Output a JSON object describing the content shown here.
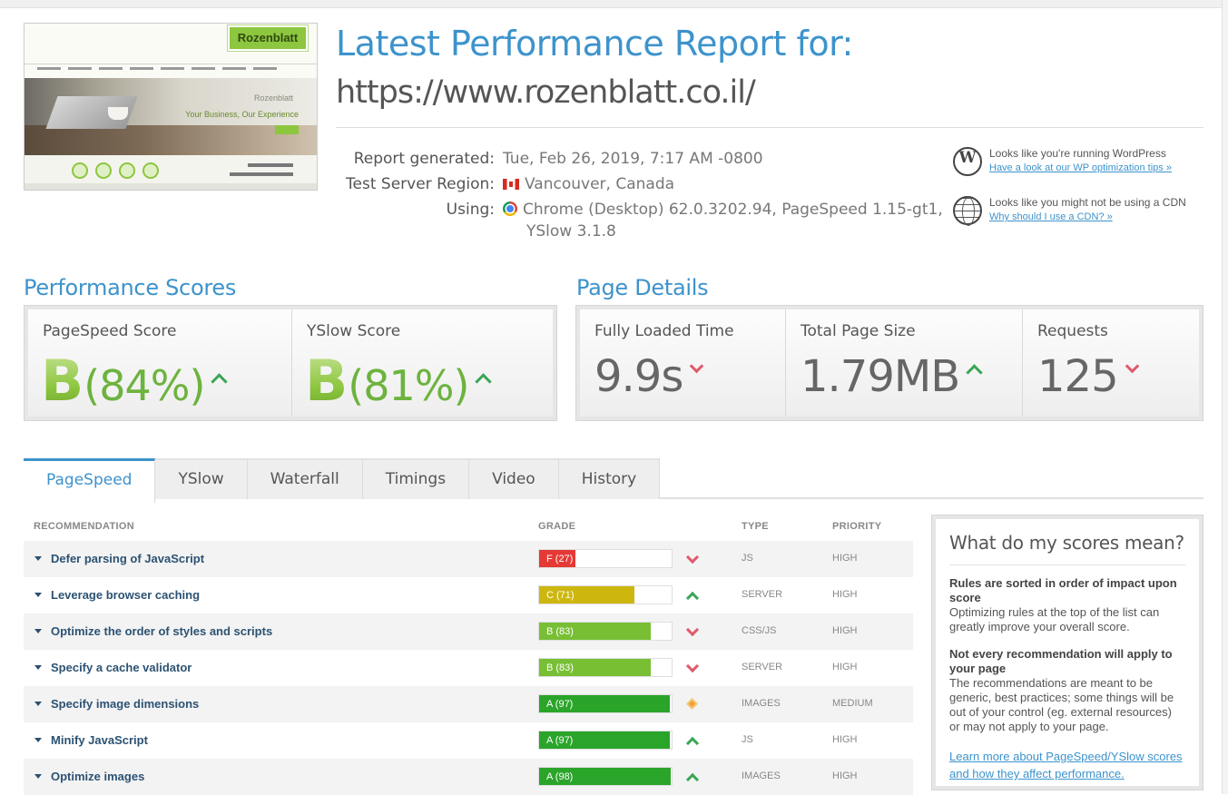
{
  "report": {
    "title": "Latest Performance Report for:",
    "url": "https://www.rozenblatt.co.il/",
    "thumbnail": {
      "logo_text": "Rozenblatt",
      "brand_text": "Rozenblatt",
      "tagline": "Your Business, Our Experience"
    },
    "generated_label": "Report generated:",
    "generated_value": "Tue, Feb 26, 2019, 7:17 AM -0800",
    "region_label": "Test Server Region:",
    "region_value": "Vancouver, Canada",
    "using_label": "Using:",
    "using_value_line1": "Chrome (Desktop) 62.0.3202.94, PageSpeed 1.15-gt1,",
    "using_value_line2": "YSlow 3.1.8"
  },
  "tips": [
    {
      "icon": "wordpress-icon",
      "text": "Looks like you're running WordPress",
      "link": "Have a look at our WP optimization tips »"
    },
    {
      "icon": "globe-icon",
      "text": "Looks like you might not be using a CDN",
      "link": "Why should I use a CDN? »"
    }
  ],
  "performance": {
    "heading": "Performance Scores",
    "pagespeed_label": "PageSpeed Score",
    "pagespeed_grade": "B",
    "pagespeed_pct": "(84%)",
    "yslow_label": "YSlow Score",
    "yslow_grade": "B",
    "yslow_pct": "(81%)"
  },
  "details": {
    "heading": "Page Details",
    "loaded_label": "Fully Loaded Time",
    "loaded_value": "9.9s",
    "size_label": "Total Page Size",
    "size_value": "1.79MB",
    "requests_label": "Requests",
    "requests_value": "125"
  },
  "tabs": [
    "PageSpeed",
    "YSlow",
    "Waterfall",
    "Timings",
    "Video",
    "History"
  ],
  "table": {
    "headers": {
      "recommendation": "RECOMMENDATION",
      "grade": "GRADE",
      "type": "TYPE",
      "priority": "PRIORITY"
    },
    "rows": [
      {
        "name": "Defer parsing of JavaScript",
        "grade": "F (27)",
        "score": 27,
        "color": "#e53935",
        "trend": "down",
        "type": "JS",
        "priority": "HIGH"
      },
      {
        "name": "Leverage browser caching",
        "grade": "C (71)",
        "score": 71,
        "color": "#cdb70e",
        "trend": "up",
        "type": "SERVER",
        "priority": "HIGH"
      },
      {
        "name": "Optimize the order of styles and scripts",
        "grade": "B (83)",
        "score": 83,
        "color": "#78bf34",
        "trend": "down",
        "type": "CSS/JS",
        "priority": "HIGH"
      },
      {
        "name": "Specify a cache validator",
        "grade": "B (83)",
        "score": 83,
        "color": "#78bf34",
        "trend": "down",
        "type": "SERVER",
        "priority": "HIGH"
      },
      {
        "name": "Specify image dimensions",
        "grade": "A (97)",
        "score": 97,
        "color": "#2aa52a",
        "trend": "neutral",
        "type": "IMAGES",
        "priority": "MEDIUM"
      },
      {
        "name": "Minify JavaScript",
        "grade": "A (97)",
        "score": 97,
        "color": "#2aa52a",
        "trend": "up",
        "type": "JS",
        "priority": "HIGH"
      },
      {
        "name": "Optimize images",
        "grade": "A (98)",
        "score": 98,
        "color": "#2aa52a",
        "trend": "up",
        "type": "IMAGES",
        "priority": "HIGH"
      }
    ]
  },
  "scores_box": {
    "heading": "What do my scores mean?",
    "b1": "Rules are sorted in order of impact upon score",
    "p1": "Optimizing rules at the top of the list can greatly improve your overall score.",
    "b2": "Not every recommendation will apply to your page",
    "p2": "The recommendations are meant to be generic, best practices; some things will be out of your control (eg. external resources) or may not apply to your page.",
    "link": "Learn more about PageSpeed/YSlow scores and how they affect performance."
  }
}
